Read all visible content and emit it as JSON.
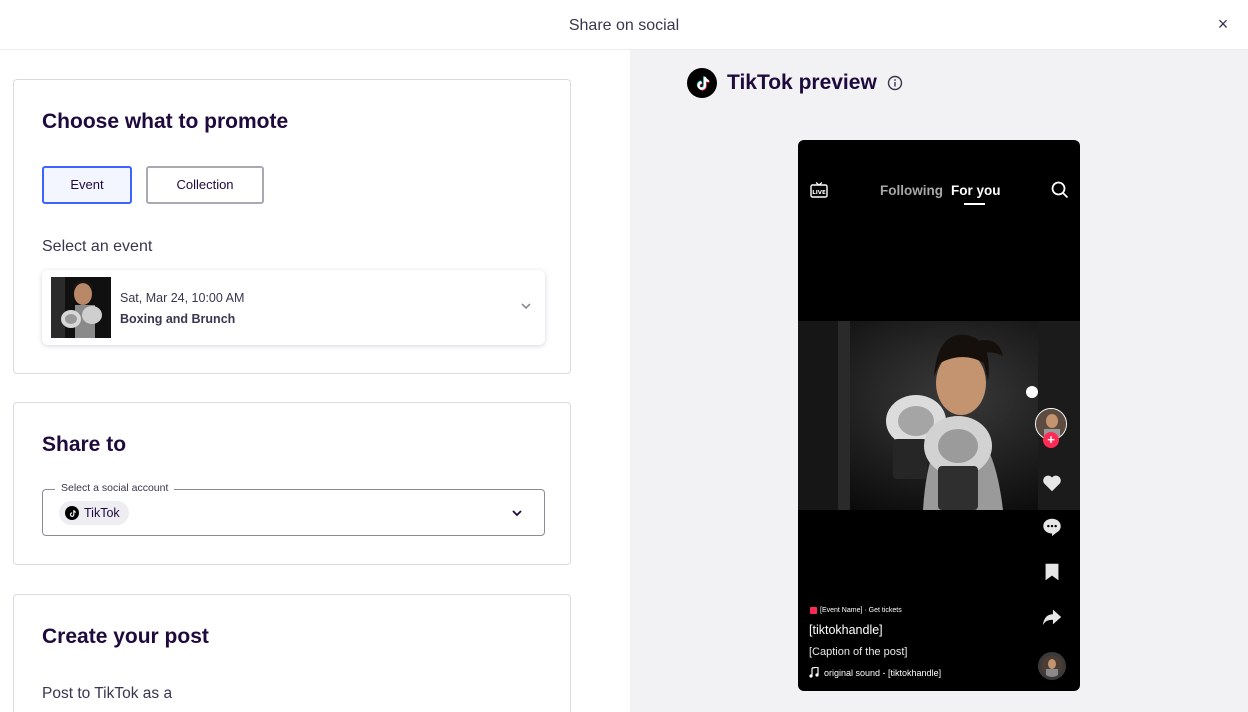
{
  "header": {
    "title": "Share on social",
    "close_glyph": "×"
  },
  "promote_card": {
    "title": "Choose what to promote",
    "options": [
      {
        "label": "Event",
        "selected": true
      },
      {
        "label": "Collection",
        "selected": false
      }
    ],
    "select_label": "Select an event",
    "selected_event": {
      "date": "Sat, Mar 24, 10:00 AM",
      "name": "Boxing and Brunch",
      "thumbnail_icon": "boxer-photo"
    }
  },
  "share_card": {
    "title": "Share to",
    "field_label": "Select a social account",
    "selected_account": "TikTok",
    "account_icon": "tiktok-icon"
  },
  "post_card": {
    "title": "Create your post",
    "post_as_label": "Post to TikTok as a"
  },
  "preview": {
    "title": "TikTok preview",
    "info_icon": "info-icon",
    "phone": {
      "tabs": [
        {
          "label": "Following",
          "active": false
        },
        {
          "label": "For you",
          "active": true
        }
      ],
      "live_icon": "live-icon",
      "search_icon": "search-icon",
      "event_tag": "[Event Name] · Get tickets",
      "handle": "[tiktokhandle]",
      "caption": "[Caption of the post]",
      "sound": "original sound - [tiktokhandle]",
      "side_icons": [
        "heart-icon",
        "comment-icon",
        "bookmark-icon",
        "share-icon"
      ]
    }
  },
  "colors": {
    "accent": "#3d64ff",
    "text": "#1e0a3c",
    "preview_bg": "#f2f2f4",
    "tiktok_red": "#fe2c55"
  }
}
